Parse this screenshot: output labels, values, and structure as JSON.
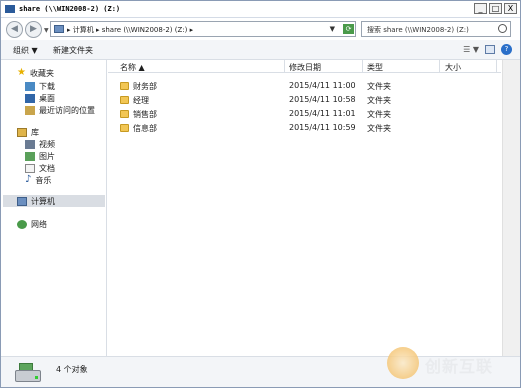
{
  "window": {
    "title": "share (\\\\WIN2008-2) (Z:)",
    "controls": {
      "minimize": "_",
      "maximize": "□",
      "close": "X"
    }
  },
  "address": {
    "crumbs": "▸ 计算机 ▸ share (\\\\WIN2008-2) (Z:) ▸",
    "search_placeholder": "搜索 share (\\\\WIN2008-2) (Z:)"
  },
  "toolbar": {
    "organize": "组织 ▼",
    "new_folder": "新建文件夹"
  },
  "nav": {
    "favorites": "收藏夹",
    "downloads": "下载",
    "desktop": "桌面",
    "recent": "最近访问的位置",
    "libraries": "库",
    "videos": "视频",
    "pictures": "图片",
    "documents": "文档",
    "music": "音乐",
    "computer": "计算机",
    "network": "网络"
  },
  "columns": {
    "name": "名称 ▲",
    "date": "修改日期",
    "type": "类型",
    "size": "大小"
  },
  "files": [
    {
      "name": "财务部",
      "date": "2015/4/11 11:00",
      "type": "文件夹",
      "size": ""
    },
    {
      "name": "经理",
      "date": "2015/4/11 10:58",
      "type": "文件夹",
      "size": ""
    },
    {
      "name": "销售部",
      "date": "2015/4/11 11:01",
      "type": "文件夹",
      "size": ""
    },
    {
      "name": "信息部",
      "date": "2015/4/11 10:59",
      "type": "文件夹",
      "size": ""
    }
  ],
  "status": {
    "count": "4 个对象"
  },
  "watermark": {
    "text": "创新互联"
  }
}
